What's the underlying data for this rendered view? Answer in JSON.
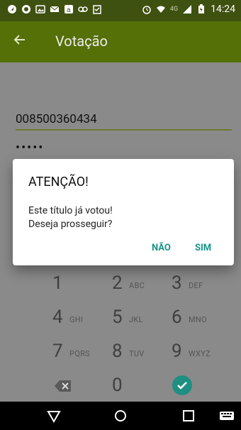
{
  "status_bar": {
    "time": "14:24",
    "network": "4G"
  },
  "app_bar": {
    "title": "Votação"
  },
  "form": {
    "document_value": "008500360434",
    "password_mask": "•••••"
  },
  "dialog": {
    "title": "ATENÇÃO!",
    "line1": "Este título já votou!",
    "line2": "Deseja prosseguir?",
    "cancel": "NÃO",
    "confirm": "SIM"
  },
  "keypad": {
    "keys": [
      {
        "num": "1",
        "letters": ""
      },
      {
        "num": "2",
        "letters": "ABC"
      },
      {
        "num": "3",
        "letters": "DEF"
      },
      {
        "num": "4",
        "letters": "GHI"
      },
      {
        "num": "5",
        "letters": "JKL"
      },
      {
        "num": "6",
        "letters": "MNO"
      },
      {
        "num": "7",
        "letters": "PQRS"
      },
      {
        "num": "8",
        "letters": "TUV"
      },
      {
        "num": "9",
        "letters": "WXYZ"
      },
      {
        "num": "0",
        "letters": ""
      }
    ]
  },
  "colors": {
    "appbar": "#547007",
    "statusbar": "#3f5110",
    "accent": "#149488"
  }
}
